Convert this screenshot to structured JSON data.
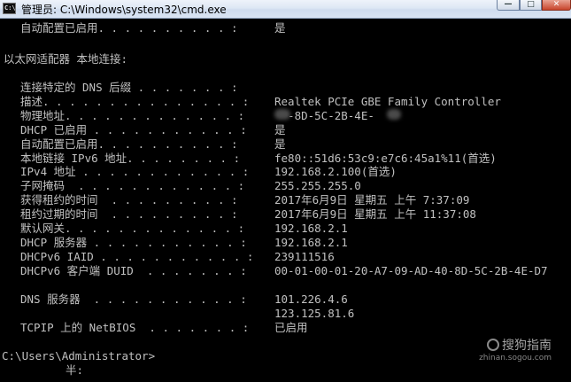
{
  "window": {
    "title": "管理员: C:\\Windows\\system32\\cmd.exe",
    "icon_text": "C:\\",
    "min_glyph": "—",
    "max_glyph": "□",
    "close_glyph": "✕"
  },
  "console": {
    "top_row": {
      "label": "自动配置已启用. . . . . . . . . . :",
      "value": "是"
    },
    "adapter_header": "以太网适配器 本地连接:",
    "rows": [
      {
        "label": "连接特定的 DNS 后缀 . . . . . . . :",
        "value": ""
      },
      {
        "label": "描述. . . . . . . . . . . . . . . :",
        "value": "Realtek PCIe GBE Family Controller"
      },
      {
        "label": "物理地址. . . . . . . . . . . . . :",
        "value": "  -8D-5C-2B-4E-"
      },
      {
        "label": "DHCP 已启用 . . . . . . . . . . . :",
        "value": "是"
      },
      {
        "label": "自动配置已启用. . . . . . . . . . :",
        "value": "是"
      },
      {
        "label": "本地链接 IPv6 地址. . . . . . . . :",
        "value": "fe80::51d6:53c9:e7c6:45a1%11(首选)"
      },
      {
        "label": "IPv4 地址 . . . . . . . . . . . . :",
        "value": "192.168.2.100(首选)"
      },
      {
        "label": "子网掩码  . . . . . . . . . . . . :",
        "value": "255.255.255.0"
      },
      {
        "label": "获得租约的时间  . . . . . . . . . :",
        "value": "2017年6月9日 星期五 上午 7:37:09"
      },
      {
        "label": "租约过期的时间  . . . . . . . . . :",
        "value": "2017年6月9日 星期五 上午 11:37:08"
      },
      {
        "label": "默认网关. . . . . . . . . . . . . :",
        "value": "192.168.2.1"
      },
      {
        "label": "DHCP 服务器 . . . . . . . . . . . :",
        "value": "192.168.2.1"
      },
      {
        "label": "DHCPv6 IAID . . . . . . . . . . . :",
        "value": "239111516"
      },
      {
        "label": "DHCPv6 客户端 DUID  . . . . . . . :",
        "value": "00-01-00-01-20-A7-09-AD-40-8D-5C-2B-4E-D7"
      }
    ],
    "dns_row": {
      "label": "DNS 服务器  . . . . . . . . . . . :",
      "value": "101.226.4.6"
    },
    "dns_row2": {
      "value": "123.125.81.6"
    },
    "netbios_row": {
      "label": "TCPIP 上的 NetBIOS  . . . . . . . :",
      "value": "已启用"
    },
    "prompt": "C:\\Users\\Administrator>",
    "ime_text": "半:"
  },
  "watermark": {
    "main": "搜狗指南",
    "sub": "zhinan.sogou.com"
  }
}
